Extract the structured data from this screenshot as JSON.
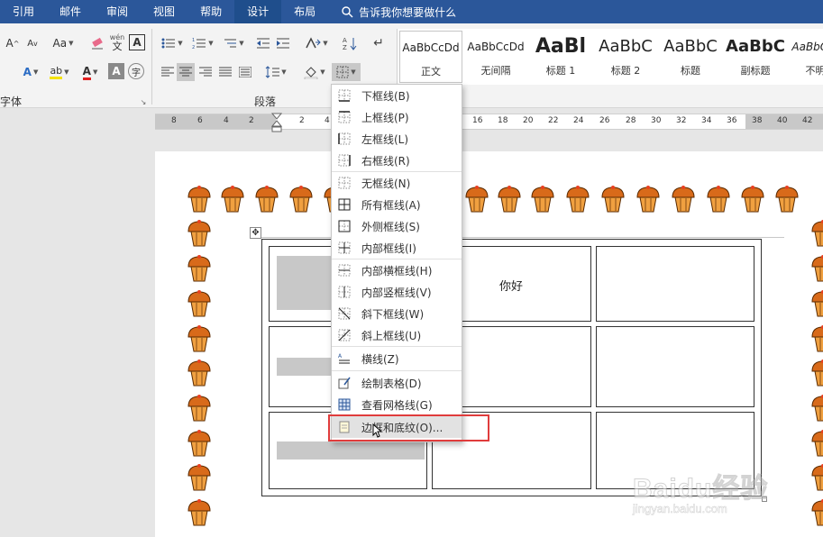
{
  "ribbon_tabs": [
    "引用",
    "邮件",
    "审阅",
    "视图",
    "帮助",
    "设计",
    "布局"
  ],
  "active_tab": "设计",
  "tell_me": "告诉我你想要做什么",
  "groups": {
    "font": "字体",
    "paragraph": "段落"
  },
  "font_buttons": {
    "grow": "A",
    "shrink": "A",
    "case": "Aa",
    "pinyin_top": "wén",
    "pinyin_bottom": "文",
    "char_border": "A",
    "font_color": "A",
    "shade": "A",
    "highlight": "ab"
  },
  "styles_gallery": [
    {
      "preview": "AaBbCcDd",
      "name": "正文"
    },
    {
      "preview": "AaBbCcDd",
      "name": "无间隔"
    },
    {
      "preview": "AaBl",
      "name": "标题 1"
    },
    {
      "preview": "AaBbC",
      "name": "标题 2"
    },
    {
      "preview": "AaBbC",
      "name": "标题"
    },
    {
      "preview": "AaBbC",
      "name": "副标题"
    },
    {
      "preview": "AaBbCcDd",
      "name": "不明显"
    }
  ],
  "ruler_ticks": [
    "8",
    "6",
    "4",
    "2",
    "2",
    "4",
    "16",
    "18",
    "20",
    "22",
    "24",
    "26",
    "28",
    "30",
    "32",
    "34",
    "36",
    "38",
    "40",
    "42"
  ],
  "table": {
    "cell_text": "你好"
  },
  "border_menu": {
    "items": [
      {
        "label": "下框线(B)",
        "icon": "bottom-border-icon"
      },
      {
        "label": "上框线(P)",
        "icon": "top-border-icon"
      },
      {
        "label": "左框线(L)",
        "icon": "left-border-icon"
      },
      {
        "label": "右框线(R)",
        "icon": "right-border-icon"
      },
      {
        "label": "无框线(N)",
        "icon": "no-border-icon"
      },
      {
        "label": "所有框线(A)",
        "icon": "all-borders-icon"
      },
      {
        "label": "外侧框线(S)",
        "icon": "outside-borders-icon"
      },
      {
        "label": "内部框线(I)",
        "icon": "inside-borders-icon"
      },
      {
        "label": "内部横框线(H)",
        "icon": "inside-horizontal-border-icon"
      },
      {
        "label": "内部竖框线(V)",
        "icon": "inside-vertical-border-icon"
      },
      {
        "label": "斜下框线(W)",
        "icon": "diagonal-down-border-icon"
      },
      {
        "label": "斜上框线(U)",
        "icon": "diagonal-up-border-icon"
      },
      {
        "label": "横线(Z)",
        "icon": "horizontal-line-icon"
      },
      {
        "label": "绘制表格(D)",
        "icon": "draw-table-icon"
      },
      {
        "label": "查看网格线(G)",
        "icon": "view-gridlines-icon"
      },
      {
        "label": "边框和底纹(O)...",
        "icon": "borders-shading-icon"
      }
    ],
    "highlighted_index": 15
  },
  "watermark": {
    "brand": "Baidu经验",
    "site": "jingyan.baidu.com"
  },
  "colors": {
    "tab_bar": "#2b579a",
    "highlight_box": "#e03c3c",
    "cupcake": "#d86a1a",
    "shading": "#c8c8c8"
  }
}
